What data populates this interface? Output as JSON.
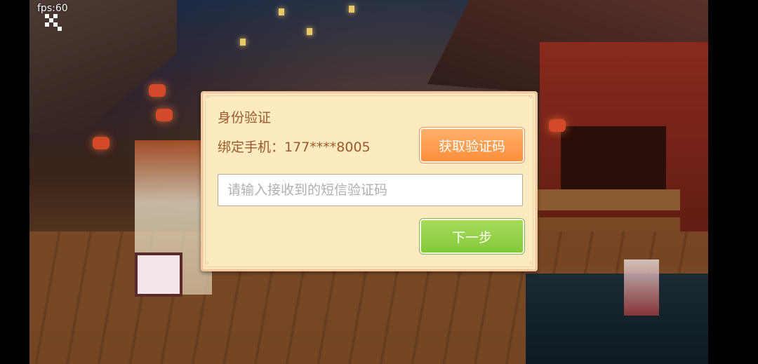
{
  "fps": {
    "label": "fps:",
    "value": "60"
  },
  "dialog": {
    "title": "身份验证",
    "phone_label": "绑定手机：",
    "phone_number": "177****8005",
    "get_code_label": "获取验证码",
    "code_placeholder": "请输入接收到的短信验证码",
    "code_value": "",
    "next_label": "下一步"
  },
  "colors": {
    "dialog_bg": "#fcebc1",
    "title_text": "#9a5a2a",
    "get_code_button": "#fc8f3c",
    "next_button": "#82c93a"
  },
  "icons": {
    "fps_overlay": "checker-arrow-icon"
  }
}
